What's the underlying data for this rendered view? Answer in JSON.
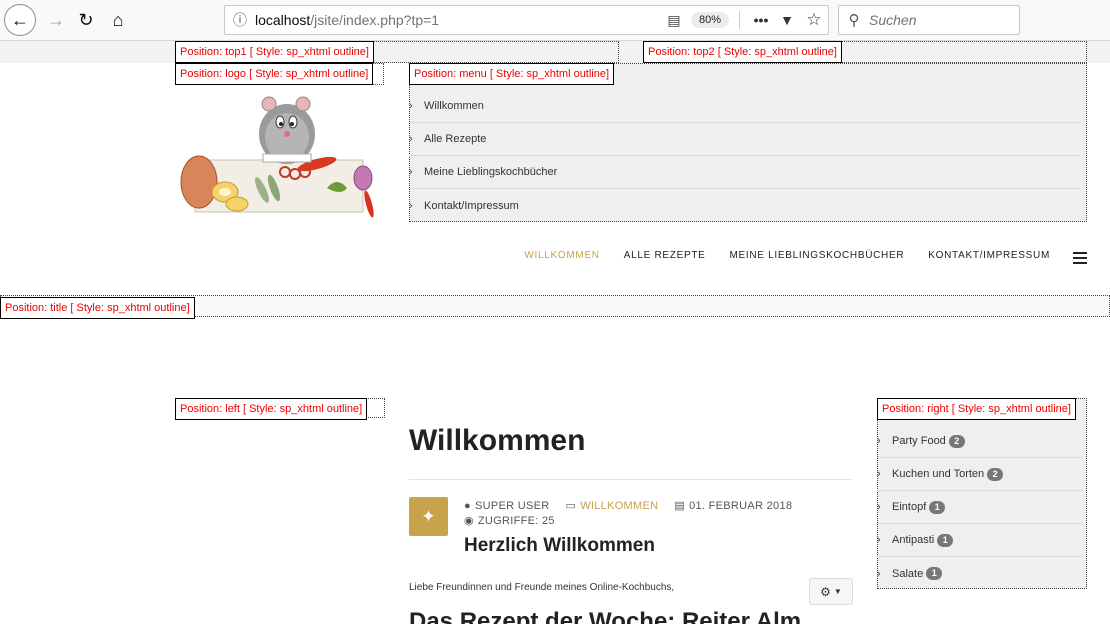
{
  "browser": {
    "url_host": "localhost",
    "url_path": "/jsite/index.php?tp=1",
    "zoom": "80%",
    "search_placeholder": "Suchen"
  },
  "positions": {
    "top1": "Position: top1 [ Style: sp_xhtml outline]",
    "top2": "Position: top2 [ Style: sp_xhtml outline]",
    "logo": "Position: logo [ Style: sp_xhtml outline]",
    "menu": "Position: menu [ Style: sp_xhtml outline]",
    "title": "Position: title [ Style: sp_xhtml outline]",
    "left": "Position: left [ Style: sp_xhtml outline]",
    "right": "Position: right [ Style: sp_xhtml outline]"
  },
  "menu": {
    "items": [
      "Willkommen",
      "Alle Rezepte",
      "Meine Lieblingskochbücher",
      "Kontakt/Impressum"
    ]
  },
  "main_nav": {
    "items": [
      "WILLKOMMEN",
      "ALLE REZEPTE",
      "MEINE LIEBLINGSKOCHBÜCHER",
      "KONTAKT/IMPRESSUM"
    ]
  },
  "article": {
    "title": "Willkommen",
    "author": "SUPER USER",
    "category": "WILLKOMMEN",
    "date": "01. FEBRUAR 2018",
    "hits": "ZUGRIFFE: 25",
    "subtitle": "Herzlich Willkommen",
    "intro": "Liebe Freundinnen und Freunde meines Online-Kochbuchs,",
    "next_heading": "Das Rezept der Woche: Reiter Alm"
  },
  "categories": {
    "items": [
      {
        "label": "Party Food",
        "count": "2"
      },
      {
        "label": "Kuchen und Torten",
        "count": "2"
      },
      {
        "label": "Eintopf",
        "count": "1"
      },
      {
        "label": "Antipasti",
        "count": "1"
      },
      {
        "label": "Salate",
        "count": "1"
      }
    ]
  },
  "colors": {
    "accent": "#c9a24c",
    "label_red": "#e00000",
    "module_bg": "#efefef"
  }
}
